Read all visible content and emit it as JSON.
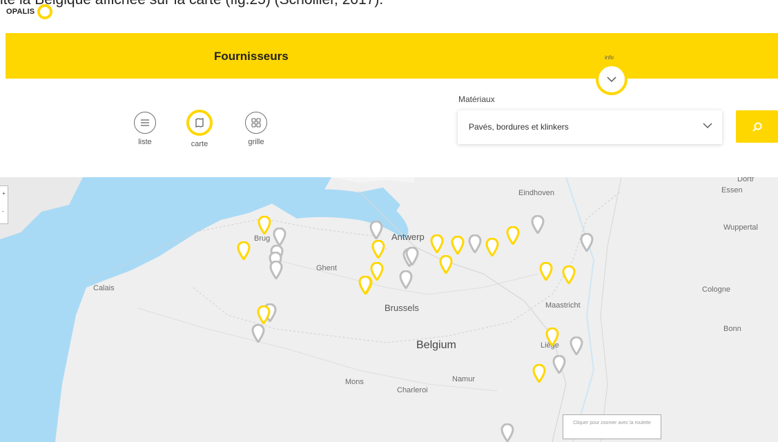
{
  "caption": "ite la Belgique affichée sur la carte (fig.25) (Schollier, 2017).",
  "brand": {
    "name": "OPALIS"
  },
  "header": {
    "title": "Fournisseurs",
    "info_label": "info"
  },
  "views": [
    {
      "label": "liste",
      "icon": "list-icon",
      "active": false
    },
    {
      "label": "carte",
      "icon": "map-icon",
      "active": true
    },
    {
      "label": "grille",
      "icon": "grid-icon",
      "active": false
    }
  ],
  "filter": {
    "label": "Matériaux",
    "selected": "Pavés, bordures et klinkers"
  },
  "colors": {
    "accent": "#ffd700",
    "marker_yellow": "#ffd700",
    "marker_grey": "#bdbdbd",
    "sea": "#a9daf5",
    "land": "#efefef"
  },
  "map": {
    "cities": [
      {
        "name": "Dortr",
        "type": "city"
      },
      {
        "name": "Essen",
        "type": "city"
      },
      {
        "name": "Eindhoven",
        "type": "city"
      },
      {
        "name": "Wuppertal",
        "type": "city"
      },
      {
        "name": "Brug",
        "type": "city"
      },
      {
        "name": "Antwerp",
        "type": "big"
      },
      {
        "name": "Ghent",
        "type": "city"
      },
      {
        "name": "Calais",
        "type": "city"
      },
      {
        "name": "Cologne",
        "type": "city"
      },
      {
        "name": "Brussels",
        "type": "big"
      },
      {
        "name": "Maastricht",
        "type": "city"
      },
      {
        "name": "Bonn",
        "type": "city"
      },
      {
        "name": "Belgium",
        "type": "country"
      },
      {
        "name": "Liège",
        "type": "city"
      },
      {
        "name": "Mons",
        "type": "city"
      },
      {
        "name": "Namur",
        "type": "city"
      },
      {
        "name": "Charleroi",
        "type": "city"
      }
    ],
    "zoom_hint": "Cliquer pour zoomer avec la roulette",
    "zoom_in": "+",
    "zoom_out": "-"
  },
  "markers": [
    {
      "kind": "yellow"
    },
    {
      "kind": "grey"
    },
    {
      "kind": "yellow"
    },
    {
      "kind": "grey"
    },
    {
      "kind": "grey"
    },
    {
      "kind": "grey"
    },
    {
      "kind": "grey"
    },
    {
      "kind": "yellow"
    },
    {
      "kind": "grey"
    },
    {
      "kind": "yellow"
    },
    {
      "kind": "yellow"
    },
    {
      "kind": "grey"
    },
    {
      "kind": "yellow"
    },
    {
      "kind": "grey"
    },
    {
      "kind": "yellow"
    },
    {
      "kind": "yellow"
    },
    {
      "kind": "yellow"
    },
    {
      "kind": "grey"
    },
    {
      "kind": "yellow"
    },
    {
      "kind": "yellow"
    },
    {
      "kind": "yellow"
    },
    {
      "kind": "grey"
    },
    {
      "kind": "grey"
    },
    {
      "kind": "grey"
    },
    {
      "kind": "yellow"
    },
    {
      "kind": "yellow"
    },
    {
      "kind": "grey"
    },
    {
      "kind": "grey"
    },
    {
      "kind": "yellow"
    },
    {
      "kind": "grey"
    },
    {
      "kind": "yellow"
    },
    {
      "kind": "grey"
    }
  ]
}
